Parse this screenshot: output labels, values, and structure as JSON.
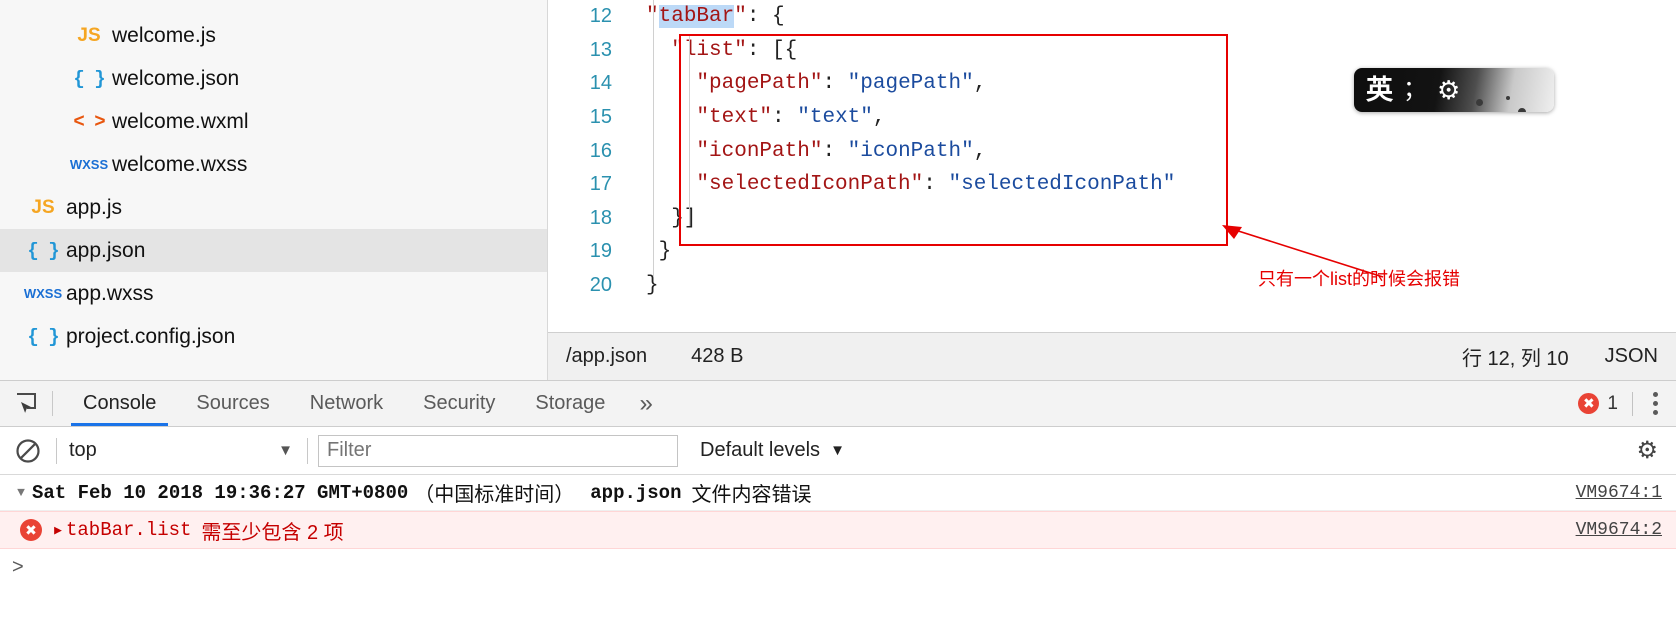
{
  "file_tree": {
    "items": [
      {
        "icon": "js-icon",
        "icon_label": "JS",
        "name": "welcome.js",
        "indent": 1,
        "selected": false
      },
      {
        "icon": "json-icon",
        "icon_label": "{ }",
        "name": "welcome.json",
        "indent": 1,
        "selected": false
      },
      {
        "icon": "wxml-icon",
        "icon_label": "< >",
        "name": "welcome.wxml",
        "indent": 1,
        "selected": false
      },
      {
        "icon": "wxss-icon",
        "icon_label": "WXSS",
        "name": "welcome.wxss",
        "indent": 1,
        "selected": false
      },
      {
        "icon": "js-icon",
        "icon_label": "JS",
        "name": "app.js",
        "indent": 0,
        "selected": false
      },
      {
        "icon": "json-icon",
        "icon_label": "{ }",
        "name": "app.json",
        "indent": 0,
        "selected": true
      },
      {
        "icon": "wxss-icon",
        "icon_label": "WXSS",
        "name": "app.wxss",
        "indent": 0,
        "selected": false
      },
      {
        "icon": "json-icon",
        "icon_label": "{ }",
        "name": "project.config.json",
        "indent": 0,
        "selected": false
      }
    ]
  },
  "editor": {
    "lines": [
      {
        "number": "12",
        "segments": [
          {
            "t": "\"",
            "c": "key"
          },
          {
            "t": "tabBar",
            "c": "sel"
          },
          {
            "t": "\"",
            "c": "key"
          },
          {
            "t": ": {",
            "c": "pun"
          }
        ]
      },
      {
        "number": "13",
        "segments": [
          {
            "t": "  ",
            "c": "pun"
          },
          {
            "t": "\"list\"",
            "c": "key"
          },
          {
            "t": ": [{",
            "c": "pun"
          }
        ]
      },
      {
        "number": "14",
        "segments": [
          {
            "t": "    ",
            "c": "pun"
          },
          {
            "t": "\"pagePath\"",
            "c": "key"
          },
          {
            "t": ": ",
            "c": "pun"
          },
          {
            "t": "\"pagePath\"",
            "c": "str"
          },
          {
            "t": ",",
            "c": "pun"
          }
        ]
      },
      {
        "number": "15",
        "segments": [
          {
            "t": "    ",
            "c": "pun"
          },
          {
            "t": "\"text\"",
            "c": "key"
          },
          {
            "t": ": ",
            "c": "pun"
          },
          {
            "t": "\"text\"",
            "c": "str"
          },
          {
            "t": ",",
            "c": "pun"
          }
        ]
      },
      {
        "number": "16",
        "segments": [
          {
            "t": "    ",
            "c": "pun"
          },
          {
            "t": "\"iconPath\"",
            "c": "key"
          },
          {
            "t": ": ",
            "c": "pun"
          },
          {
            "t": "\"iconPath\"",
            "c": "str"
          },
          {
            "t": ",",
            "c": "pun"
          }
        ]
      },
      {
        "number": "17",
        "segments": [
          {
            "t": "    ",
            "c": "pun"
          },
          {
            "t": "\"selectedIconPath\"",
            "c": "key"
          },
          {
            "t": ": ",
            "c": "pun"
          },
          {
            "t": "\"selectedIconPath\"",
            "c": "str"
          }
        ]
      },
      {
        "number": "18",
        "segments": [
          {
            "t": "  }]",
            "c": "pun"
          }
        ]
      },
      {
        "number": "19",
        "segments": [
          {
            "t": " }",
            "c": "pun"
          }
        ]
      },
      {
        "number": "20",
        "segments": [
          {
            "t": "}",
            "c": "pun"
          }
        ]
      }
    ],
    "annotation": {
      "text": "只有一个list的时候会报错",
      "color": "#e60000"
    },
    "ime": {
      "language_label": "英",
      "separator_label": "；",
      "gear_icon": "gear-icon"
    },
    "status": {
      "path": "/app.json",
      "size": "428 B",
      "cursor": "行 12, 列 10",
      "language": "JSON"
    }
  },
  "devtools": {
    "inspect_icon": "inspect-element-icon",
    "tabs": [
      {
        "label": "Console",
        "active": true
      },
      {
        "label": "Sources",
        "active": false
      },
      {
        "label": "Network",
        "active": false
      },
      {
        "label": "Security",
        "active": false
      },
      {
        "label": "Storage",
        "active": false
      }
    ],
    "more_tabs_label": "»",
    "error_badge": {
      "icon": "error-icon",
      "count": "1"
    },
    "kebab_icon": "more-options-icon",
    "filterbar": {
      "clear_icon": "clear-console-icon",
      "context": "top",
      "context_caret": "▼",
      "filter_placeholder": "Filter",
      "filter_value": "",
      "levels_label": "Default levels",
      "levels_caret": "▼",
      "settings_icon": "settings-gear-icon"
    },
    "messages": [
      {
        "type": "info",
        "expander": "▼",
        "timestamp": "Sat Feb 10 2018 19:36:27 GMT+0800",
        "timezone": "（中国标准时间）",
        "source_file": "app.json",
        "text": "文件内容错误",
        "link": "VM9674:1"
      },
      {
        "type": "error",
        "expander": "▶",
        "icon": "error-icon",
        "code": "tabBar.list",
        "text": "需至少包含 2 项",
        "link": "VM9674:2"
      }
    ],
    "prompt_symbol": ">"
  },
  "colors": {
    "accent_blue": "#1a73e8",
    "error_red": "#e94335",
    "annotation_red": "#e60000",
    "json_key": "#a31515",
    "json_string": "#1b4b9e",
    "gutter": "#2b91af",
    "selection": "#bcd9f7"
  }
}
